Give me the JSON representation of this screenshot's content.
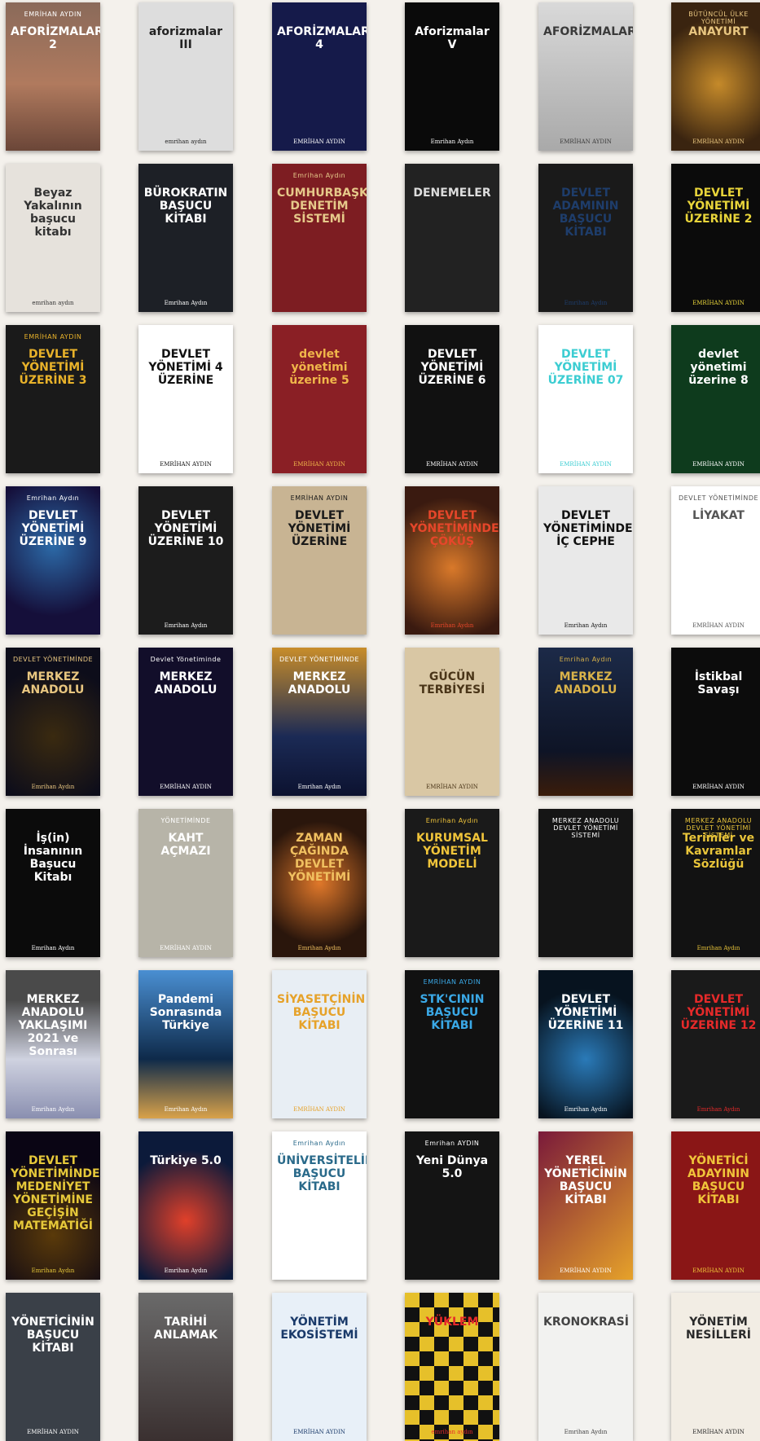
{
  "books": [
    {
      "sub": "EMRİHAN AYDIN",
      "title": "AFORİZMALAR 2",
      "author": "",
      "bg": "linear-gradient(#8a6a5a,#b07a5e 55%,#6b4638)",
      "fg": "#ffffff"
    },
    {
      "sub": "",
      "title": "aforizmalar III",
      "author": "emrihan aydın",
      "bg": "#dddddd",
      "fg": "#222222"
    },
    {
      "sub": "",
      "title": "AFORİZMALAR 4",
      "author": "EMRİHAN AYDIN",
      "bg": "#151a4a",
      "fg": "#ffffff"
    },
    {
      "sub": "",
      "title": "Aforizmalar V",
      "author": "Emrihan Aydın",
      "bg": "#0a0a0a",
      "fg": "#ffffff"
    },
    {
      "sub": "",
      "title": "AFORİZMALAR",
      "author": "EMRİHAN AYDIN",
      "bg": "linear-gradient(#d9d9d9,#a9a9a9)",
      "fg": "#3a3a3a"
    },
    {
      "sub": "BÜTÜNCÜL ÜLKE YÖNETİMİ",
      "title": "ANAYURT",
      "author": "EMRİHAN AYDIN",
      "bg": "radial-gradient(circle at 50% 55%,#c58a2a,#3a2410 70%)",
      "fg": "#e8c680"
    },
    {
      "sub": "",
      "title": "Beyaz Yakalının başucu kitabı",
      "author": "emrihan aydın",
      "bg": "#e6e2dc",
      "fg": "#333333"
    },
    {
      "sub": "",
      "title": "BÜROKRATIN BAŞUCU KİTABI",
      "author": "Emrihan Aydın",
      "bg": "#1d2026",
      "fg": "#ffffff"
    },
    {
      "sub": "Emrihan Aydın",
      "title": "CUMHURBAŞKANLIĞI DENETİM SİSTEMİ",
      "author": "",
      "bg": "#7d1d22",
      "fg": "#e6c98a"
    },
    {
      "sub": "",
      "title": "DENEMELER",
      "author": "",
      "bg": "#222222",
      "fg": "#dddddd"
    },
    {
      "sub": "",
      "title": "DEVLET ADAMININ BAŞUCU KİTABI",
      "author": "Emrihan Aydın",
      "bg": "#1a1a1a",
      "fg": "#1e3d6b"
    },
    {
      "sub": "",
      "title": "DEVLET YÖNETİMİ ÜZERİNE 2",
      "author": "EMRİHAN AYDIN",
      "bg": "#0b0b0b",
      "fg": "#e8d43a"
    },
    {
      "sub": "EMRİHAN AYDIN",
      "title": "DEVLET YÖNETİMİ ÜZERİNE 3",
      "author": "",
      "bg": "#1a1a1a",
      "fg": "#e8b22a"
    },
    {
      "sub": "",
      "title": "DEVLET YÖNETİMİ 4 ÜZERİNE",
      "author": "EMRİHAN AYDIN",
      "bg": "#ffffff",
      "fg": "#111111"
    },
    {
      "sub": "",
      "title": "devlet yönetimi üzerine 5",
      "author": "EMRİHAN AYDIN",
      "bg": "#8a1f25",
      "fg": "#f0b64a"
    },
    {
      "sub": "",
      "title": "DEVLET YÖNETİMİ ÜZERİNE 6",
      "author": "EMRİHAN AYDIN",
      "bg": "#111111",
      "fg": "#ffffff"
    },
    {
      "sub": "",
      "title": "DEVLET YÖNETİMİ ÜZERİNE 07",
      "author": "EMRİHAN AYDIN",
      "bg": "#ffffff",
      "fg": "#3ccdd2"
    },
    {
      "sub": "",
      "title": "devlet yönetimi üzerine 8",
      "author": "EMRİHAN AYDIN",
      "bg": "#0e3b1d",
      "fg": "#ffffff"
    },
    {
      "sub": "Emrihan Aydın",
      "title": "DEVLET YÖNETİMİ ÜZERİNE 9",
      "author": "",
      "bg": "radial-gradient(circle at 50% 40%,#2c6aa8,#150f3a 70%)",
      "fg": "#ffffff"
    },
    {
      "sub": "",
      "title": "DEVLET YÖNETİMİ ÜZERİNE 10",
      "author": "Emrihan Aydın",
      "bg": "#1c1c1c",
      "fg": "#ffffff"
    },
    {
      "sub": "EMRİHAN AYDIN",
      "title": "DEVLET YÖNETİMİ ÜZERİNE",
      "author": "",
      "bg": "#c8b493",
      "fg": "#1a1a1a"
    },
    {
      "sub": "",
      "title": "DEVLET YÖNETİMİNDE ÇÖKÜŞ",
      "author": "Emrihan Aydın",
      "bg": "radial-gradient(circle at 50% 55%,#d9792a,#3a1a10 75%)",
      "fg": "#e6462a"
    },
    {
      "sub": "",
      "title": "DEVLET YÖNETİMİNDE İÇ CEPHE",
      "author": "Emrihan Aydın",
      "bg": "#e9e9e9",
      "fg": "#111111"
    },
    {
      "sub": "DEVLET YÖNETİMİNDE",
      "title": "LİYAKAT",
      "author": "EMRİHAN AYDIN",
      "bg": "#ffffff",
      "fg": "#555555"
    },
    {
      "sub": "DEVLET YÖNETİMİNDE",
      "title": "MERKEZ ANADOLU",
      "author": "Emrihan Aydın",
      "bg": "radial-gradient(circle at 50% 60%,#3a2a10,#0d0d1a 70%)",
      "fg": "#e8c680"
    },
    {
      "sub": "Devlet Yönetiminde",
      "title": "MERKEZ ANADOLU",
      "author": "EMRİHAN AYDIN",
      "bg": "#120e2a",
      "fg": "#ffffff"
    },
    {
      "sub": "DEVLET YÖNETİMİNDE",
      "title": "MERKEZ ANADOLU",
      "author": "Emrihan Aydın",
      "bg": "linear-gradient(#c88d2a,#1b2a55 60%,#0c1230)",
      "fg": "#ffffff"
    },
    {
      "sub": "",
      "title": "GÜCÜN TERBİYESİ",
      "author": "EMRİHAN AYDIN",
      "bg": "#d9c7a4",
      "fg": "#4a3518"
    },
    {
      "sub": "Emrihan Aydın",
      "title": "MERKEZ ANADOLU",
      "author": "",
      "bg": "linear-gradient(#1c2a48,#0e1426 70%,#3a1c0a)",
      "fg": "#d9b24a"
    },
    {
      "sub": "",
      "title": "İstikbal Savaşı",
      "author": "EMRİHAN AYDIN",
      "bg": "#0c0c0c",
      "fg": "#ffffff"
    },
    {
      "sub": "",
      "title": "İş(in) İnsanının Başucu Kitabı",
      "author": "Emrihan Aydın",
      "bg": "#0b0b0b",
      "fg": "#ffffff"
    },
    {
      "sub": "YÖNETİMİNDE",
      "title": "KAHT AÇMAZI",
      "author": "EMRİHAN AYDIN",
      "bg": "#b7b4a8",
      "fg": "#ffffff"
    },
    {
      "sub": "",
      "title": "ZAMAN ÇAĞINDA DEVLET YÖNETİMİ",
      "author": "Emrihan Aydın",
      "bg": "radial-gradient(circle at 50% 50%,#e0782a,#2a160c 70%)",
      "fg": "#f0c060"
    },
    {
      "sub": "Emrihan Aydın",
      "title": "KURUMSAL YÖNETİM MODELİ",
      "author": "",
      "bg": "#1a1a1a",
      "fg": "#f0c43a"
    },
    {
      "sub": "MERKEZ ANADOLU DEVLET YÖNETİMİ SİSTEMİ",
      "title": "",
      "author": "",
      "bg": "#151515",
      "fg": "#ffffff"
    },
    {
      "sub": "MERKEZ ANADOLU DEVLET YÖNETİMİ SİSTEMİ",
      "title": "Terimler ve Kavramlar Sözlüğü",
      "author": "Emrihan Aydın",
      "bg": "#121212",
      "fg": "#e8c43a"
    },
    {
      "sub": "",
      "title": "MERKEZ ANADOLU YAKLAŞIMI 2021 ve Sonrası",
      "author": "Emrihan Aydın",
      "bg": "linear-gradient(#4a4a4a 20%,#cfd2e0 60%,#8a8fb0)",
      "fg": "#ffffff"
    },
    {
      "sub": "",
      "title": "Pandemi Sonrasında Türkiye",
      "author": "Emrihan Aydın",
      "bg": "linear-gradient(#4a8fd2,#0e2a4a 60%,#d9a24a)",
      "fg": "#ffffff"
    },
    {
      "sub": "",
      "title": "SİYASETÇİNİN BAŞUCU KİTABI",
      "author": "EMRİHAN AYDIN",
      "bg": "#e8eef4",
      "fg": "#e6a22a"
    },
    {
      "sub": "EMRİHAN AYDIN",
      "title": "STK'CININ BAŞUCU KİTABI",
      "author": "",
      "bg": "#111111",
      "fg": "#3aa8e6"
    },
    {
      "sub": "",
      "title": "DEVLET YÖNETİMİ ÜZERİNE 11",
      "author": "Emrihan Aydın",
      "bg": "radial-gradient(circle at 50% 60%,#2a7ab8,#07131f 70%)",
      "fg": "#ffffff"
    },
    {
      "sub": "",
      "title": "DEVLET YÖNETİMİ ÜZERİNE 12",
      "author": "Emrihan Aydın",
      "bg": "#1a1a1a",
      "fg": "#e62a2a"
    },
    {
      "sub": "",
      "title": "DEVLET YÖNETİMİNDEN MEDENİYET YÖNETİMİNE GEÇİŞİN MATEMATİĞİ",
      "author": "Emrihan Aydın",
      "bg": "radial-gradient(circle at 50% 70%,#5a3a0a,#0a0514 70%)",
      "fg": "#e6c83a"
    },
    {
      "sub": "",
      "title": "Türkiye 5.0",
      "author": "Emrihan Aydın",
      "bg": "radial-gradient(circle at 50% 60%,#e0402a,#0c1a3a 70%)",
      "fg": "#ffffff"
    },
    {
      "sub": "Emrihan Aydın",
      "title": "ÜNİVERSİTELİNİN BAŞUCU KİTABI",
      "author": "",
      "bg": "#ffffff",
      "fg": "#2a6a8a"
    },
    {
      "sub": "Emrihan AYDIN",
      "title": "Yeni Dünya 5.0",
      "author": "",
      "bg": "#141414",
      "fg": "#ffffff"
    },
    {
      "sub": "",
      "title": "YEREL YÖNETİCİNİN BAŞUCU KİTABI",
      "author": "EMRİHAN AYDIN",
      "bg": "linear-gradient(135deg,#7a1a3a,#e6a22a)",
      "fg": "#ffffff"
    },
    {
      "sub": "",
      "title": "YÖNETİCİ ADAYININ BAŞUCU KİTABI",
      "author": "EMRİHAN AYDIN",
      "bg": "#8a1616",
      "fg": "#f0c43a"
    },
    {
      "sub": "",
      "title": "YÖNETİCİNİN BAŞUCU KİTABI",
      "author": "EMRİHAN AYDIN",
      "bg": "#3a4048",
      "fg": "#ffffff"
    },
    {
      "sub": "",
      "title": "TARİHİ ANLAMAK",
      "author": "",
      "bg": "linear-gradient(#6a6a6a,#3a3030)",
      "fg": "#ffffff"
    },
    {
      "sub": "",
      "title": "YÖNETİM EKOSİSTEMİ",
      "author": "EMRİHAN AYDIN",
      "bg": "#e8f0f8",
      "fg": "#1a3a6a"
    },
    {
      "sub": "",
      "title": "YÜKLEM",
      "author": "emrihan aydın",
      "bg": "repeating-conic-gradient(#111 0 25%,#e6c02a 0 50%) 0 0/36px 36px",
      "fg": "#e62a2a"
    },
    {
      "sub": "",
      "title": "KRONOKRASİ",
      "author": "Emrihan Aydın",
      "bg": "#f2f2f0",
      "fg": "#444444"
    },
    {
      "sub": "",
      "title": "YÖNETİM NESİLLERİ",
      "author": "EMRİHAN AYDIN",
      "bg": "#f2ede4",
      "fg": "#2a2a2a"
    }
  ]
}
